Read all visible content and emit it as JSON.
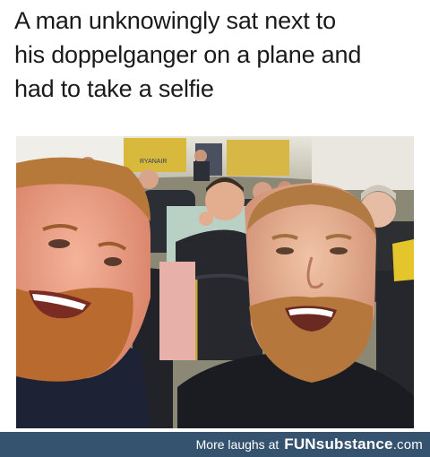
{
  "caption": {
    "line1": "A man unknowingly sat next to",
    "line2": "his doppelganger on a plane and",
    "line3": "had to take a selfie"
  },
  "photo": {
    "alt": "Two bearded men taking a selfie in an airplane cabin",
    "cabin_sign": "RYANAIR"
  },
  "footer": {
    "prefix": "More laughs at",
    "brand_fun": "FUN",
    "brand_sub": "substance",
    "brand_tld": ".com",
    "bg_color": "#35536f"
  }
}
